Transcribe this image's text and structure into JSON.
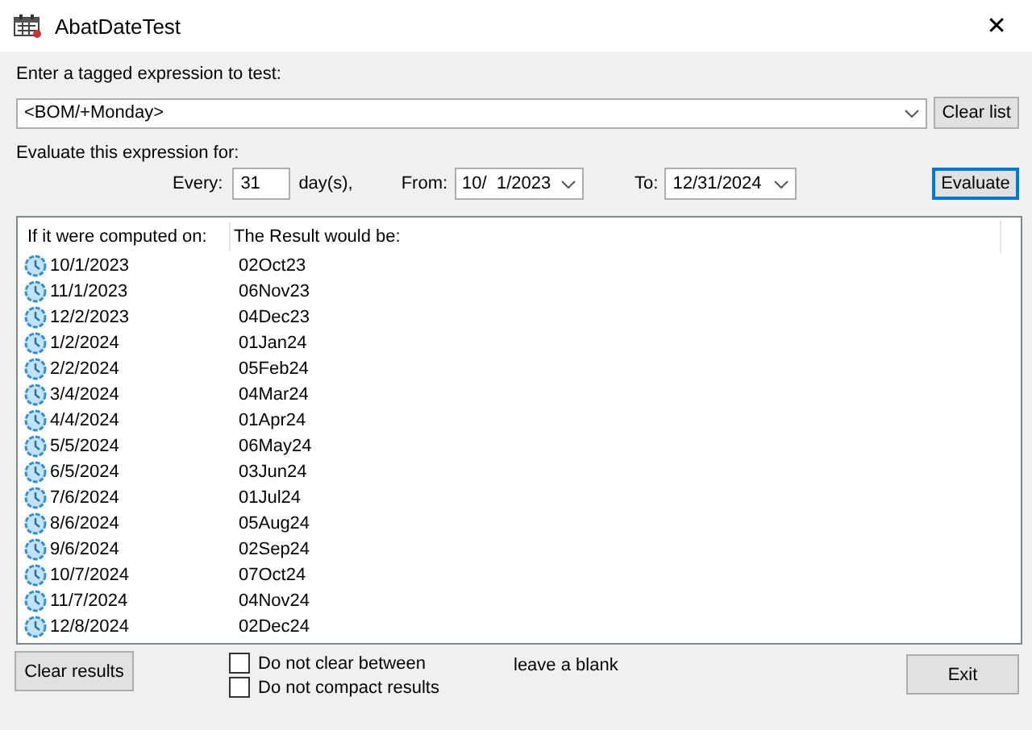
{
  "window": {
    "title": "AbatDateTest",
    "close": "✕"
  },
  "expression": {
    "label": "Enter a tagged expression to test:",
    "value": "<BOM/+Monday>",
    "clear_button": "Clear list"
  },
  "evaluate": {
    "label": "Evaluate this expression for:",
    "every_label": "Every:",
    "every_value": "31",
    "unit": "day(s),",
    "from_label": "From:",
    "from_value": "10/  1/2023",
    "to_label": "To:",
    "to_value": "12/31/2024",
    "button": "Evaluate"
  },
  "results": {
    "columns": [
      "If it were computed on:",
      "The Result would be:"
    ],
    "rows": [
      {
        "date": "10/1/2023",
        "result": "02Oct23"
      },
      {
        "date": "11/1/2023",
        "result": "06Nov23"
      },
      {
        "date": "12/2/2023",
        "result": "04Dec23"
      },
      {
        "date": "1/2/2024",
        "result": "01Jan24"
      },
      {
        "date": "2/2/2024",
        "result": "05Feb24"
      },
      {
        "date": "3/4/2024",
        "result": "04Mar24"
      },
      {
        "date": "4/4/2024",
        "result": "01Apr24"
      },
      {
        "date": "5/5/2024",
        "result": "06May24"
      },
      {
        "date": "6/5/2024",
        "result": "03Jun24"
      },
      {
        "date": "7/6/2024",
        "result": "01Jul24"
      },
      {
        "date": "8/6/2024",
        "result": "05Aug24"
      },
      {
        "date": "9/6/2024",
        "result": "02Sep24"
      },
      {
        "date": "10/7/2024",
        "result": "07Oct24"
      },
      {
        "date": "11/7/2024",
        "result": "04Nov24"
      },
      {
        "date": "12/8/2024",
        "result": "02Dec24"
      }
    ]
  },
  "footer": {
    "clear_button": "Clear results",
    "options": [
      {
        "label": "Do not clear between",
        "checked": false
      },
      {
        "label": "Do not compact results",
        "checked": false
      }
    ],
    "note": "leave a blank",
    "exit_button": "Exit"
  }
}
